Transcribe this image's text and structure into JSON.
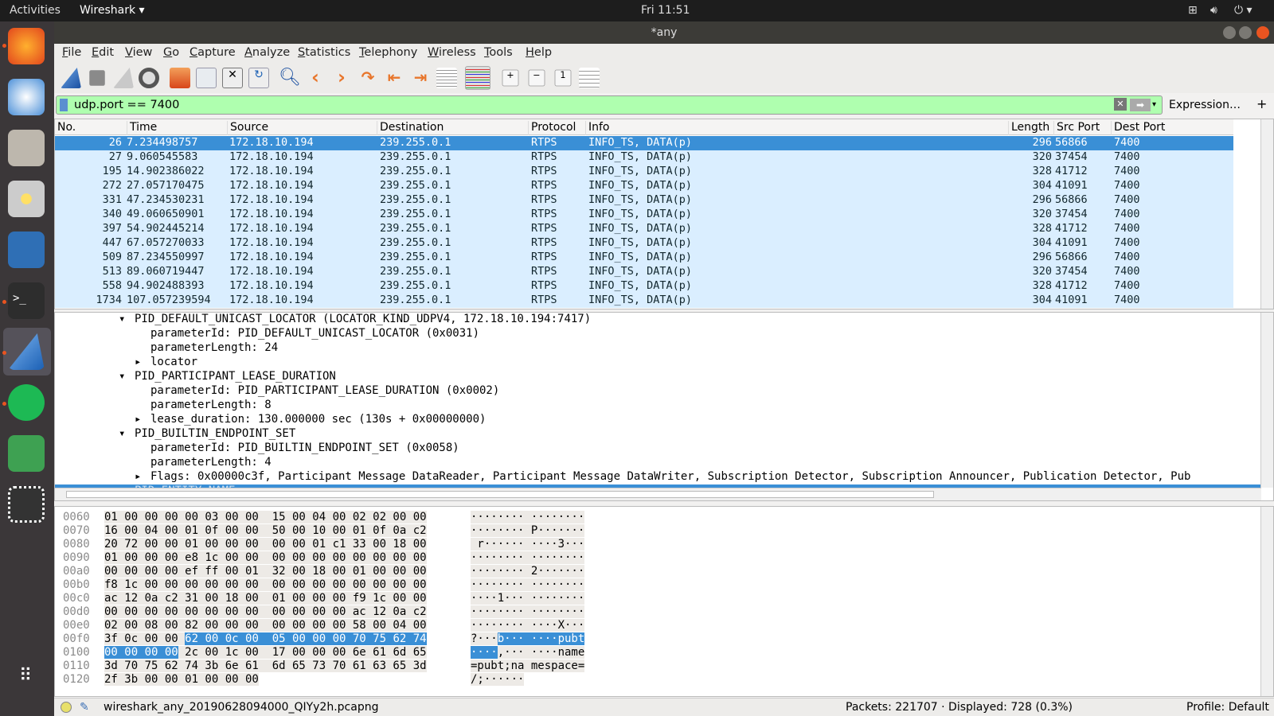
{
  "topbar": {
    "activities": "Activities",
    "app": "Wireshark ▾",
    "clock": "Fri 11:51"
  },
  "window": {
    "title": "*any"
  },
  "menu": [
    "File",
    "Edit",
    "View",
    "Go",
    "Capture",
    "Analyze",
    "Statistics",
    "Telephony",
    "Wireless",
    "Tools",
    "Help"
  ],
  "toolbar": [
    "start-capture",
    "stop-capture",
    "restart-capture",
    "capture-options",
    "open-file",
    "save-file",
    "close-file",
    "reload-file",
    "find-packet",
    "go-back",
    "go-forward",
    "go-to-packet",
    "first-packet",
    "last-packet",
    "auto-scroll",
    "colorize",
    "zoom-in",
    "zoom-out",
    "normal-size",
    "resize-columns"
  ],
  "filter": {
    "value": "udp.port == 7400",
    "expression": "Expression…",
    "plus": "+"
  },
  "columns": [
    "No.",
    "Time",
    "Source",
    "Destination",
    "Protocol",
    "Info",
    "Length",
    "Src Port",
    "Dest Port"
  ],
  "packets": [
    [
      "26",
      "7.234498757",
      "172.18.10.194",
      "239.255.0.1",
      "RTPS",
      "INFO_TS, DATA(p)",
      "296",
      "56866",
      "7400"
    ],
    [
      "27",
      "9.060545583",
      "172.18.10.194",
      "239.255.0.1",
      "RTPS",
      "INFO_TS, DATA(p)",
      "320",
      "37454",
      "7400"
    ],
    [
      "195",
      "14.902386022",
      "172.18.10.194",
      "239.255.0.1",
      "RTPS",
      "INFO_TS, DATA(p)",
      "328",
      "41712",
      "7400"
    ],
    [
      "272",
      "27.057170475",
      "172.18.10.194",
      "239.255.0.1",
      "RTPS",
      "INFO_TS, DATA(p)",
      "304",
      "41091",
      "7400"
    ],
    [
      "331",
      "47.234530231",
      "172.18.10.194",
      "239.255.0.1",
      "RTPS",
      "INFO_TS, DATA(p)",
      "296",
      "56866",
      "7400"
    ],
    [
      "340",
      "49.060650901",
      "172.18.10.194",
      "239.255.0.1",
      "RTPS",
      "INFO_TS, DATA(p)",
      "320",
      "37454",
      "7400"
    ],
    [
      "397",
      "54.902445214",
      "172.18.10.194",
      "239.255.0.1",
      "RTPS",
      "INFO_TS, DATA(p)",
      "328",
      "41712",
      "7400"
    ],
    [
      "447",
      "67.057270033",
      "172.18.10.194",
      "239.255.0.1",
      "RTPS",
      "INFO_TS, DATA(p)",
      "304",
      "41091",
      "7400"
    ],
    [
      "509",
      "87.234550997",
      "172.18.10.194",
      "239.255.0.1",
      "RTPS",
      "INFO_TS, DATA(p)",
      "296",
      "56866",
      "7400"
    ],
    [
      "513",
      "89.060719447",
      "172.18.10.194",
      "239.255.0.1",
      "RTPS",
      "INFO_TS, DATA(p)",
      "320",
      "37454",
      "7400"
    ],
    [
      "558",
      "94.902488393",
      "172.18.10.194",
      "239.255.0.1",
      "RTPS",
      "INFO_TS, DATA(p)",
      "328",
      "41712",
      "7400"
    ],
    [
      "1734",
      "107.057239594",
      "172.18.10.194",
      "239.255.0.1",
      "RTPS",
      "INFO_TS, DATA(p)",
      "304",
      "41091",
      "7400"
    ]
  ],
  "details": [
    {
      "indent": 1,
      "arrow": "▾",
      "text": "PID_DEFAULT_UNICAST_LOCATOR (LOCATOR_KIND_UDPV4, 172.18.10.194:7417)"
    },
    {
      "indent": 2,
      "arrow": "",
      "text": "parameterId: PID_DEFAULT_UNICAST_LOCATOR (0x0031)"
    },
    {
      "indent": 2,
      "arrow": "",
      "text": "parameterLength: 24"
    },
    {
      "indent": 2,
      "arrow": "▸",
      "text": "locator"
    },
    {
      "indent": 1,
      "arrow": "▾",
      "text": "PID_PARTICIPANT_LEASE_DURATION"
    },
    {
      "indent": 2,
      "arrow": "",
      "text": "parameterId: PID_PARTICIPANT_LEASE_DURATION (0x0002)"
    },
    {
      "indent": 2,
      "arrow": "",
      "text": "parameterLength: 8"
    },
    {
      "indent": 2,
      "arrow": "▸",
      "text": "lease_duration: 130.000000 sec (130s + 0x00000000)"
    },
    {
      "indent": 1,
      "arrow": "▾",
      "text": "PID_BUILTIN_ENDPOINT_SET"
    },
    {
      "indent": 2,
      "arrow": "",
      "text": "parameterId: PID_BUILTIN_ENDPOINT_SET (0x0058)"
    },
    {
      "indent": 2,
      "arrow": "",
      "text": "parameterLength: 4"
    },
    {
      "indent": 2,
      "arrow": "▸",
      "text": "Flags: 0x00000c3f, Participant Message DataReader, Participant Message DataWriter, Subscription Detector, Subscription Announcer, Publication Detector, Pub"
    },
    {
      "indent": 1,
      "arrow": "▾",
      "text": "PID_ENTITY_NAME",
      "selected": true
    }
  ],
  "hex": [
    {
      "off": "0060",
      "bytes": "01 00 00 00 00 03 00 00  15 00 04 00 02 02 00 00",
      "ascii": "········ ········"
    },
    {
      "off": "0070",
      "bytes": "16 00 04 00 01 0f 00 00  50 00 10 00 01 0f 0a c2",
      "ascii": "········ P·······"
    },
    {
      "off": "0080",
      "bytes": "20 72 00 00 01 00 00 00  00 00 01 c1 33 00 18 00",
      "ascii": " r······ ····3···"
    },
    {
      "off": "0090",
      "bytes": "01 00 00 00 e8 1c 00 00  00 00 00 00 00 00 00 00",
      "ascii": "········ ········"
    },
    {
      "off": "00a0",
      "bytes": "00 00 00 00 ef ff 00 01  32 00 18 00 01 00 00 00",
      "ascii": "········ 2·······"
    },
    {
      "off": "00b0",
      "bytes": "f8 1c 00 00 00 00 00 00  00 00 00 00 00 00 00 00",
      "ascii": "········ ········"
    },
    {
      "off": "00c0",
      "bytes": "ac 12 0a c2 31 00 18 00  01 00 00 00 f9 1c 00 00",
      "ascii": "····1··· ········"
    },
    {
      "off": "00d0",
      "bytes": "00 00 00 00 00 00 00 00  00 00 00 00 ac 12 0a c2",
      "ascii": "········ ········"
    },
    {
      "off": "00e0",
      "bytes": "02 00 08 00 82 00 00 00  00 00 00 00 58 00 04 00",
      "ascii": "········ ····X···"
    },
    {
      "off": "00f0",
      "bytes_pre": "3f 0c 00 00 ",
      "bytes_hl": "62 00 0c 00  05 00 00 00 70 75 62 74",
      "ascii_pre": "?···",
      "ascii_hl": "b··· ····pubt"
    },
    {
      "off": "0100",
      "bytes_hl": "00 00 00 00",
      "bytes_post": " 2c 00 1c 00  17 00 00 00 6e 61 6d 65",
      "ascii_hl": "····",
      "ascii_post": ",··· ····name"
    },
    {
      "off": "0110",
      "bytes": "3d 70 75 62 74 3b 6e 61  6d 65 73 70 61 63 65 3d",
      "ascii": "=pubt;na mespace="
    },
    {
      "off": "0120",
      "bytes": "2f 3b 00 00 01 00 00 00",
      "ascii": "/;······"
    }
  ],
  "status": {
    "file": "wireshark_any_20190628094000_QIYy2h.pcapng",
    "packets": "Packets: 221707 · Displayed: 728 (0.3%)",
    "profile": "Profile: Default"
  },
  "colors": {
    "selected": "#3a8fd6",
    "row": "#daeeff",
    "filter_ok": "#afffaf"
  }
}
